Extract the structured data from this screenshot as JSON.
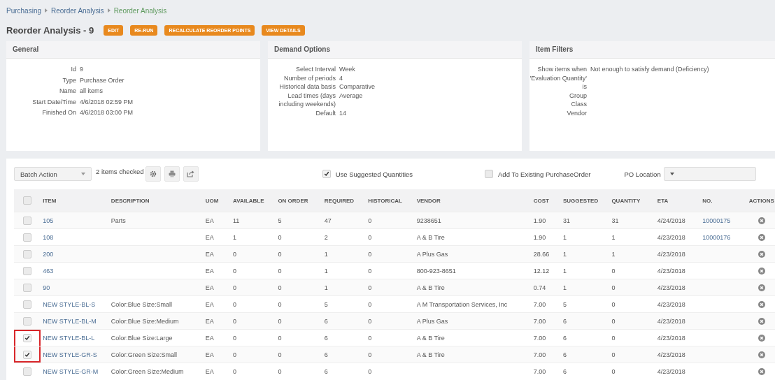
{
  "breadcrumb": [
    {
      "label": "Purchasing",
      "current": false
    },
    {
      "label": "Reorder Analysis",
      "current": false
    },
    {
      "label": "Reorder Analysis",
      "current": true
    }
  ],
  "title": "Reorder Analysis - 9",
  "actions": [
    "EDIT",
    "RE-RUN",
    "RECALCULATE REORDER POINTS",
    "VIEW DETAILS"
  ],
  "panels": [
    {
      "title": "General",
      "fields": [
        {
          "label": "Id",
          "value": "9"
        },
        {
          "label": "Type",
          "value": "Purchase Order"
        },
        {
          "label": "Name",
          "value": "all items"
        },
        {
          "label": "Start Date/Time",
          "value": "4/6/2018 02:59 PM"
        },
        {
          "label": "Finished On",
          "value": "4/6/2018 03:00 PM"
        }
      ]
    },
    {
      "title": "Demand Options",
      "fields": [
        {
          "label": "Select Interval",
          "value": "Week"
        },
        {
          "label": "Number of periods",
          "value": "4"
        },
        {
          "label": "Historical data basis",
          "value": "Comparative"
        },
        {
          "label": "Lead times (days including weekends)",
          "value": "Average"
        },
        {
          "label": "Default",
          "value": "14"
        }
      ]
    },
    {
      "title": "Item Filters",
      "fields": [
        {
          "label": "Show items when 'Evaluation Quantity' is",
          "value": "Not enough to satisfy demand (Deficiency)"
        },
        {
          "label": "Group"
        },
        {
          "label": "Class"
        },
        {
          "label": "Vendor"
        }
      ]
    }
  ],
  "toolbar": {
    "batch_action": "Batch Action",
    "checked_count": "2 items checked",
    "use_suggested": {
      "label": "Use Suggested Quantities",
      "checked": true
    },
    "add_existing": {
      "label": "Add To Existing PurchaseOrder",
      "checked": false
    },
    "po_location": {
      "label": "PO Location"
    }
  },
  "table": {
    "header_checked": false,
    "columns": [
      "ITEM",
      "DESCRIPTION",
      "UOM",
      "AVAILABLE",
      "ON ORDER",
      "REQUIRED",
      "HISTORICAL",
      "VENDOR",
      "COST",
      "SUGGESTED",
      "QUANTITY",
      "ETA",
      "NO.",
      "ACTIONS"
    ],
    "rows": [
      {
        "checked": false,
        "highlighted": false,
        "cells": [
          "105",
          "Parts",
          "EA",
          "11",
          "5",
          "47",
          "0",
          "9238651",
          "1.90",
          "31",
          "31",
          "4/24/2018",
          "10000175"
        ]
      },
      {
        "checked": false,
        "highlighted": false,
        "cells": [
          "108",
          "",
          "EA",
          "1",
          "0",
          "2",
          "0",
          "A & B Tire",
          "1.90",
          "1",
          "1",
          "4/23/2018",
          "10000176"
        ]
      },
      {
        "checked": false,
        "highlighted": false,
        "cells": [
          "200",
          "",
          "EA",
          "0",
          "0",
          "1",
          "0",
          "A Plus Gas",
          "28.66",
          "1",
          "1",
          "4/23/2018",
          ""
        ]
      },
      {
        "checked": false,
        "highlighted": false,
        "cells": [
          "463",
          "",
          "EA",
          "0",
          "0",
          "1",
          "0",
          "800-923-8651",
          "12.12",
          "1",
          "0",
          "4/23/2018",
          ""
        ]
      },
      {
        "checked": false,
        "highlighted": false,
        "cells": [
          "90",
          "",
          "EA",
          "0",
          "0",
          "1",
          "0",
          "A & B Tire",
          "0.74",
          "1",
          "0",
          "4/23/2018",
          ""
        ]
      },
      {
        "checked": false,
        "highlighted": false,
        "cells": [
          "NEW STYLE-BL-S",
          "Color:Blue Size:Small",
          "EA",
          "0",
          "0",
          "5",
          "0",
          "A M Transportation Services, Inc",
          "7.00",
          "5",
          "0",
          "4/23/2018",
          ""
        ]
      },
      {
        "checked": false,
        "highlighted": false,
        "cells": [
          "NEW STYLE-BL-M",
          "Color:Blue Size:Medium",
          "EA",
          "0",
          "0",
          "6",
          "0",
          "A Plus Gas",
          "7.00",
          "6",
          "0",
          "4/23/2018",
          ""
        ]
      },
      {
        "checked": true,
        "highlighted": true,
        "cells": [
          "NEW STYLE-BL-L",
          "Color:Blue Size:Large",
          "EA",
          "0",
          "0",
          "6",
          "0",
          "A & B Tire",
          "7.00",
          "6",
          "0",
          "4/23/2018",
          ""
        ]
      },
      {
        "checked": true,
        "highlighted": true,
        "cells": [
          "NEW STYLE-GR-S",
          "Color:Green Size:Small",
          "EA",
          "0",
          "0",
          "6",
          "0",
          "A & B Tire",
          "7.00",
          "6",
          "0",
          "4/23/2018",
          ""
        ]
      },
      {
        "checked": false,
        "highlighted": false,
        "cells": [
          "NEW STYLE-GR-M",
          "Color:Green Size:Medium",
          "EA",
          "0",
          "0",
          "6",
          "0",
          "",
          "7.00",
          "6",
          "0",
          "4/23/2018",
          ""
        ]
      }
    ]
  }
}
